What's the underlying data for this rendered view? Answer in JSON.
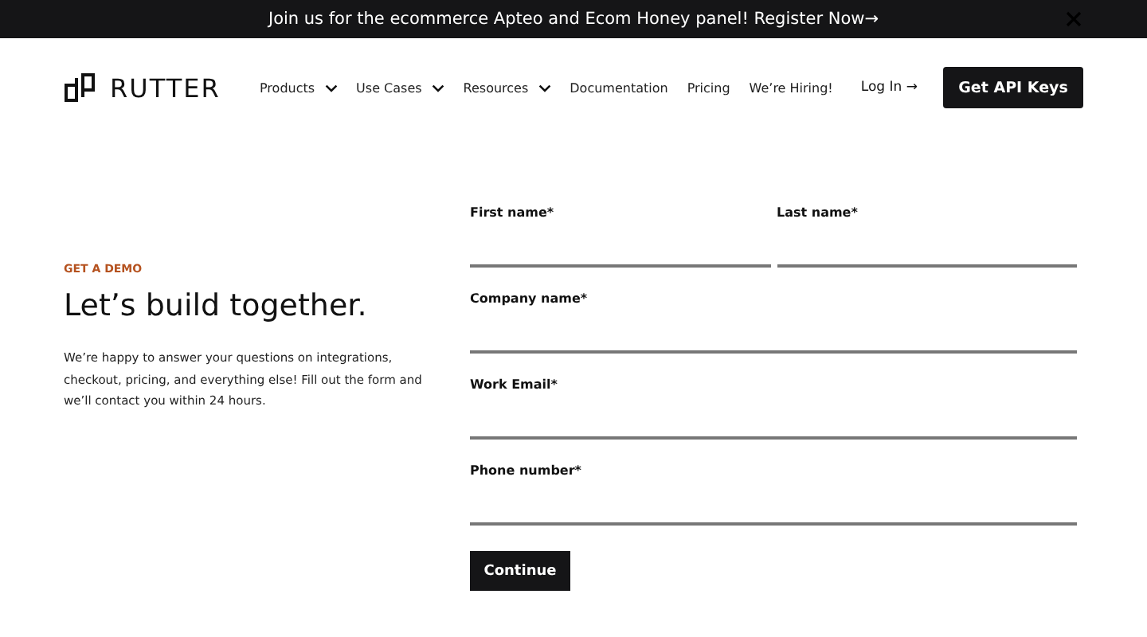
{
  "banner": {
    "text": "Join us for the ecommerce Apteo and Ecom Honey panel! Register Now→"
  },
  "header": {
    "logo": "RUTTER",
    "nav": [
      {
        "label": "Products",
        "dropdown": true
      },
      {
        "label": "Use Cases",
        "dropdown": true
      },
      {
        "label": "Resources",
        "dropdown": true
      },
      {
        "label": "Documentation",
        "dropdown": false
      },
      {
        "label": "Pricing",
        "dropdown": false
      },
      {
        "label": "We’re Hiring!",
        "dropdown": false
      }
    ],
    "login": "Log In →",
    "cta": "Get API Keys"
  },
  "intro": {
    "eyebrow": "GET A DEMO",
    "heading": "Let’s build together.",
    "body": "We’re happy to answer your questions on integrations, checkout, pricing, and everything else! Fill out the form and we’ll contact you within 24 hours."
  },
  "form": {
    "rows": [
      [
        {
          "label": "First name*"
        },
        {
          "label": "Last name*"
        }
      ],
      [
        {
          "label": "Company name*"
        }
      ],
      [
        {
          "label": "Work Email*"
        }
      ],
      [
        {
          "label": "Phone number*"
        }
      ]
    ],
    "submit": "Continue"
  }
}
